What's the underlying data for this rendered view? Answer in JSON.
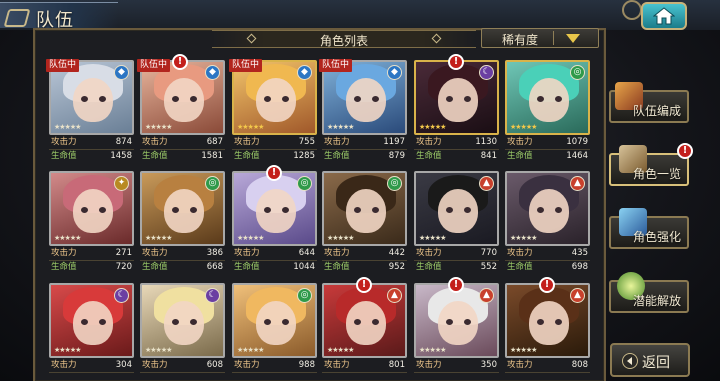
{
  "screen": {
    "title": "队伍",
    "list_header": "角色列表",
    "sort_label": "稀有度"
  },
  "sidebar": {
    "items": [
      {
        "label": "队伍编成",
        "alert": false
      },
      {
        "label": "角色一览",
        "alert": true
      },
      {
        "label": "角色强化",
        "alert": false
      },
      {
        "label": "潜能解放",
        "alert": false
      }
    ],
    "back_label": "返回"
  },
  "stat_labels": {
    "atk": "攻击力",
    "hp": "生命值"
  },
  "party_tag_label": "队伍中",
  "alert_glyph": "!",
  "characters": [
    {
      "atk": "874",
      "hp": "1458",
      "element": "water",
      "party": true,
      "alert": false,
      "rarity": "silver"
    },
    {
      "atk": "687",
      "hp": "1581",
      "element": "water",
      "party": true,
      "alert": true,
      "rarity": "silver"
    },
    {
      "atk": "755",
      "hp": "1285",
      "element": "water",
      "party": true,
      "alert": false,
      "rarity": "gold"
    },
    {
      "atk": "1197",
      "hp": "879",
      "element": "water",
      "party": true,
      "alert": false,
      "rarity": "silver"
    },
    {
      "atk": "1130",
      "hp": "841",
      "element": "dark",
      "party": false,
      "alert": true,
      "rarity": "gold"
    },
    {
      "atk": "1079",
      "hp": "1464",
      "element": "wind",
      "party": false,
      "alert": false,
      "rarity": "gold"
    },
    {
      "atk": "271",
      "hp": "720",
      "element": "light",
      "party": false,
      "alert": false,
      "rarity": "silver"
    },
    {
      "atk": "386",
      "hp": "668",
      "element": "wind",
      "party": false,
      "alert": false,
      "rarity": "silver"
    },
    {
      "atk": "644",
      "hp": "1044",
      "element": "wind",
      "party": false,
      "alert": true,
      "rarity": "silver"
    },
    {
      "atk": "442",
      "hp": "952",
      "element": "wind",
      "party": false,
      "alert": false,
      "rarity": "silver"
    },
    {
      "atk": "770",
      "hp": "552",
      "element": "fire",
      "party": false,
      "alert": false,
      "rarity": "silver"
    },
    {
      "atk": "435",
      "hp": "698",
      "element": "fire",
      "party": false,
      "alert": false,
      "rarity": "silver"
    },
    {
      "atk": "304",
      "hp": "",
      "element": "dark",
      "party": false,
      "alert": false,
      "rarity": "silver"
    },
    {
      "atk": "608",
      "hp": "",
      "element": "dark",
      "party": false,
      "alert": false,
      "rarity": "silver"
    },
    {
      "atk": "988",
      "hp": "",
      "element": "wind",
      "party": false,
      "alert": false,
      "rarity": "silver"
    },
    {
      "atk": "801",
      "hp": "",
      "element": "fire",
      "party": false,
      "alert": true,
      "rarity": "silver"
    },
    {
      "atk": "350",
      "hp": "",
      "element": "fire",
      "party": false,
      "alert": true,
      "rarity": "silver"
    },
    {
      "atk": "808",
      "hp": "",
      "element": "fire",
      "party": false,
      "alert": true,
      "rarity": "silver"
    }
  ],
  "colors": {
    "accent_gold": "#d9b34a",
    "alert_red": "#c31f1b",
    "party_red": "#b2251e",
    "home_teal": "#49c3d0"
  },
  "icons": [
    "home-icon",
    "sort-arrow-icon",
    "alert-icon",
    "water-element-icon",
    "fire-element-icon",
    "dark-element-icon",
    "wind-element-icon",
    "light-element-icon",
    "back-arrow-icon"
  ]
}
